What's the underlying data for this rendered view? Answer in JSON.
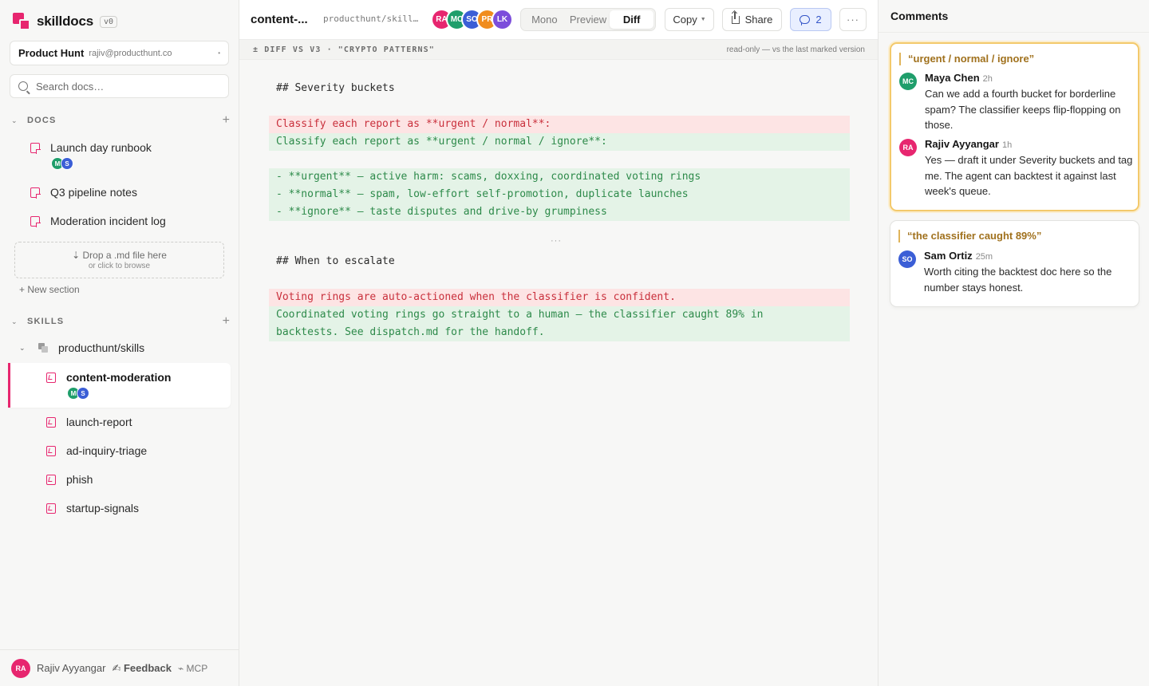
{
  "app": {
    "name": "skilldocs",
    "version": "v0",
    "workspace_name": "Product Hunt",
    "workspace_email": "rajiv@producthunt.co",
    "search_placeholder": "Search docs…"
  },
  "colors": {
    "brand": "#e7266f",
    "diff_add_bg": "#e4f3e7",
    "diff_del_bg": "#fde4e4",
    "quote_accent": "#a0711d"
  },
  "sidebar": {
    "docs_title": "DOCS",
    "docs": [
      {
        "label": "Launch day runbook",
        "avatars": [
          {
            "initials": "M",
            "color": "#1f9e6b"
          },
          {
            "initials": "S",
            "color": "#3b5ed6"
          }
        ]
      },
      {
        "label": "Q3 pipeline notes"
      },
      {
        "label": "Moderation incident log"
      }
    ],
    "drop_title": "⇣ Drop a .md file here",
    "drop_sub": "or click to browse",
    "new_section": "+ New section",
    "skills_title": "SKILLS",
    "repo": "producthunt/skills",
    "skills": [
      {
        "label": "content-moderation",
        "active": true,
        "avatars": [
          {
            "initials": "M",
            "color": "#1f9e6b"
          },
          {
            "initials": "S",
            "color": "#3b5ed6"
          }
        ]
      },
      {
        "label": "launch-report"
      },
      {
        "label": "ad-inquiry-triage"
      },
      {
        "label": "phish"
      },
      {
        "label": "startup-signals"
      }
    ],
    "footer": {
      "user_initials": "RA",
      "user_name": "Rajiv Ayyangar",
      "feedback": "✍ Feedback",
      "mcp": "⌁ MCP"
    }
  },
  "header": {
    "doc_title": "content-...",
    "doc_path": "producthunt/skills/content-moderation",
    "avatars": [
      {
        "initials": "RA",
        "color": "#e7266f"
      },
      {
        "initials": "MC",
        "color": "#1f9e6b"
      },
      {
        "initials": "SO",
        "color": "#3b5ed6"
      },
      {
        "initials": "PR",
        "color": "#f08c1e"
      },
      {
        "initials": "LK",
        "color": "#7c4ddb"
      }
    ],
    "view_modes": [
      "Mono",
      "Preview",
      "Diff"
    ],
    "active_mode": "Diff",
    "copy_label": "Copy",
    "share_label": "Share",
    "comment_count": "2",
    "more_label": "···"
  },
  "diff": {
    "label": "± DIFF  VS V3 · \"CRYPTO PATTERNS\"",
    "status": "read-only — vs the last marked version",
    "lines": [
      {
        "kind": "heading",
        "text": "## Severity buckets"
      },
      {
        "kind": "del",
        "text": "Classify each report as **urgent / normal**:"
      },
      {
        "kind": "add",
        "text": "Classify each report as **urgent / normal / ignore**:"
      },
      {
        "kind": "add",
        "text": "- **urgent** — active harm: scams, doxxing, coordinated voting rings"
      },
      {
        "kind": "add",
        "text": "- **normal** — spam, low-effort self-promotion, duplicate launches"
      },
      {
        "kind": "add",
        "text": "- **ignore** — taste disputes and drive-by grumpiness"
      },
      {
        "kind": "heading",
        "text": "## When to escalate"
      },
      {
        "kind": "del",
        "text": "Voting rings are auto-actioned when the classifier is confident."
      },
      {
        "kind": "add",
        "text": "Coordinated voting rings go straight to a human — the classifier caught 89% in"
      },
      {
        "kind": "add",
        "text": "backtests. See dispatch.md for the handoff."
      }
    ],
    "gap": "···"
  },
  "comments": {
    "title": "Comments",
    "threads": [
      {
        "quote": "“urgent / normal / ignore”",
        "focused": true,
        "items": [
          {
            "initials": "MC",
            "color": "#1f9e6b",
            "name": "Maya Chen",
            "time": "2h",
            "text": "Can we add a fourth bucket for borderline spam? The classifier keeps flip-flopping on those."
          },
          {
            "initials": "RA",
            "color": "#e7266f",
            "name": "Rajiv Ayyangar",
            "time": "1h",
            "text": "Yes — draft it under Severity buckets and tag me. The agent can backtest it against last week's queue."
          }
        ]
      },
      {
        "quote": "“the classifier caught 89%”",
        "focused": false,
        "items": [
          {
            "initials": "SO",
            "color": "#3b5ed6",
            "name": "Sam Ortiz",
            "time": "25m",
            "text": "Worth citing the backtest doc here so the number stays honest."
          }
        ]
      }
    ]
  }
}
